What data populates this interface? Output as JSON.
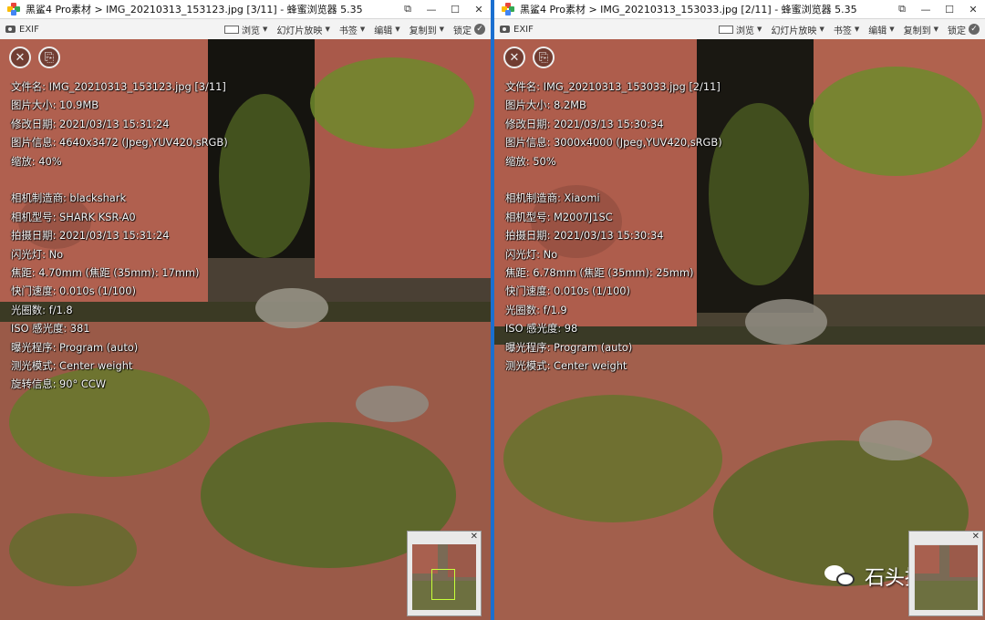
{
  "left": {
    "title": "黑鲨4 Pro素材 > IMG_20210313_153123.jpg [3/11] - 蜂蜜浏览器 5.35",
    "toolbar": {
      "exif": "EXIF",
      "browse": "浏览",
      "slideshow": "幻灯片放映",
      "bookmark": "书签",
      "edit": "编辑",
      "copy_to": "复制到",
      "lock": "锁定"
    },
    "info": {
      "l1": "文件名: IMG_20210313_153123.jpg [3/11]",
      "l2": "图片大小: 10.9MB",
      "l3": "修改日期: 2021/03/13 15:31:24",
      "l4": "图片信息: 4640x3472 (Jpeg,YUV420,sRGB)",
      "l5": "缩放: 40%",
      "l6": "相机制造商: blackshark",
      "l7": "相机型号: SHARK KSR-A0",
      "l8": "拍摄日期: 2021/03/13 15:31:24",
      "l9": "闪光灯: No",
      "l10": "焦距: 4.70mm (焦距 (35mm): 17mm)",
      "l11": "快门速度: 0.010s (1/100)",
      "l12": "光圈数: f/1.8",
      "l13": "ISO 感光度: 381",
      "l14": "曝光程序: Program (auto)",
      "l15": "测光模式: Center weight",
      "l16": "旋转信息: 90° CCW"
    }
  },
  "right": {
    "title": "黑鲨4 Pro素材 > IMG_20210313_153033.jpg [2/11] - 蜂蜜浏览器 5.35",
    "toolbar": {
      "exif": "EXIF",
      "browse": "浏览",
      "slideshow": "幻灯片放映",
      "bookmark": "书签",
      "edit": "编辑",
      "copy_to": "复制到",
      "lock": "锁定"
    },
    "info": {
      "l1": "文件名: IMG_20210313_153033.jpg [2/11]",
      "l2": "图片大小: 8.2MB",
      "l3": "修改日期: 2021/03/13 15:30:34",
      "l4": "图片信息: 3000x4000 (Jpeg,YUV420,sRGB)",
      "l5": "缩放: 50%",
      "l6": "相机制造商: Xiaomi",
      "l7": "相机型号: M2007J1SC",
      "l8": "拍摄日期: 2021/03/13 15:30:34",
      "l9": "闪光灯: No",
      "l10": "焦距: 6.78mm (焦距 (35mm): 25mm)",
      "l11": "快门速度: 0.010s (1/100)",
      "l12": "光圈数: f/1.9",
      "l13": "ISO 感光度: 98",
      "l14": "曝光程序: Program (auto)",
      "l15": "测光模式: Center weight"
    }
  },
  "watermark": "石头搞机",
  "icons": {
    "window_controls": [
      "pin-icon",
      "minimize-icon",
      "maximize-icon",
      "close-icon"
    ],
    "overlay": [
      "close-circle-icon",
      "copy-circle-icon"
    ]
  },
  "colors": {
    "divider": "#1a6fd0",
    "brick": "#b0604f",
    "moss": "#6f8a2c"
  }
}
